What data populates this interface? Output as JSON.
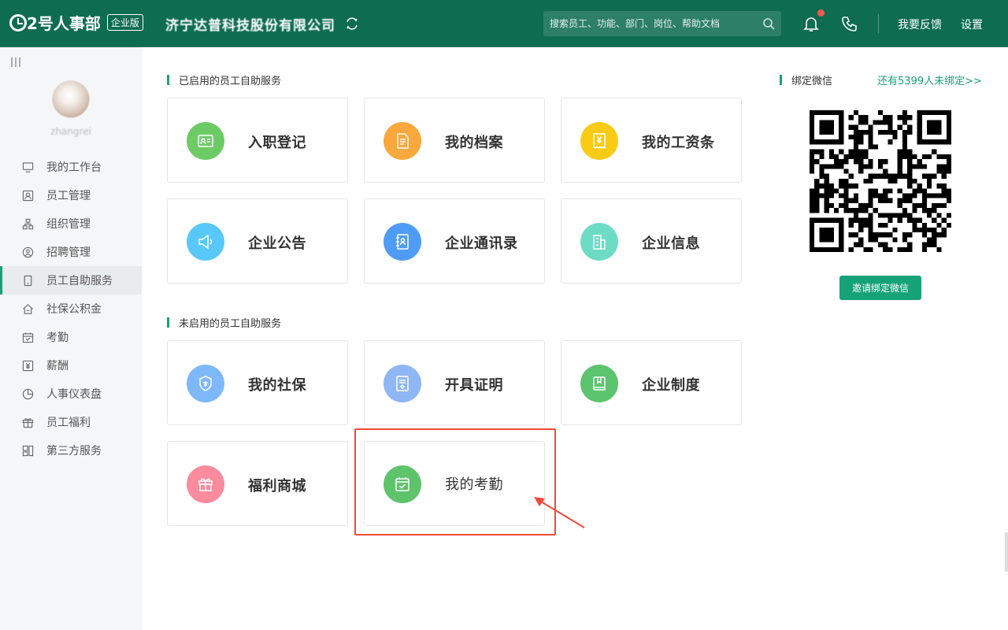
{
  "topbar": {
    "logo_text": "2号人事部",
    "edition": "企业版",
    "company": "济宁达普科技股份有限公司",
    "search_placeholder": "搜索员工、功能、部门、岗位、帮助文档",
    "feedback": "我要反馈",
    "settings": "设置"
  },
  "sidebar": {
    "username": "zhangrei",
    "items": [
      {
        "label": "我的工作台",
        "icon": "monitor-icon"
      },
      {
        "label": "员工管理",
        "icon": "id-card-icon"
      },
      {
        "label": "组织管理",
        "icon": "org-chart-icon"
      },
      {
        "label": "招聘管理",
        "icon": "recruit-icon"
      },
      {
        "label": "员工自助服务",
        "icon": "mobile-icon",
        "active": true
      },
      {
        "label": "社保公积金",
        "icon": "house-icon"
      },
      {
        "label": "考勤",
        "icon": "calendar-icon"
      },
      {
        "label": "薪酬",
        "icon": "yen-icon"
      },
      {
        "label": "人事仪表盘",
        "icon": "pie-icon"
      },
      {
        "label": "员工福利",
        "icon": "gift-icon"
      },
      {
        "label": "第三方服务",
        "icon": "apps-icon"
      }
    ]
  },
  "main": {
    "enabled_title": "已启用的员工自助服务",
    "disabled_title": "未启用的员工自助服务",
    "enabled": [
      {
        "label": "入职登记",
        "color": "#6dcb66",
        "icon": "id-card-icon"
      },
      {
        "label": "我的档案",
        "color": "#f8a83c",
        "icon": "document-icon"
      },
      {
        "label": "我的工资条",
        "color": "#f9cb14",
        "icon": "payslip-icon"
      },
      {
        "label": "企业公告",
        "color": "#58c8fa",
        "icon": "megaphone-icon"
      },
      {
        "label": "企业通讯录",
        "color": "#4f9cf6",
        "icon": "contacts-book-icon"
      },
      {
        "label": "企业信息",
        "color": "#6ddcc5",
        "icon": "building-icon"
      }
    ],
    "disabled": [
      {
        "label": "我的社保",
        "color": "#7fb7fb",
        "icon": "shield-icon"
      },
      {
        "label": "开具证明",
        "color": "#8fb6f5",
        "icon": "certificate-icon"
      },
      {
        "label": "企业制度",
        "color": "#5dc46e",
        "icon": "rules-book-icon"
      },
      {
        "label": "福利商城",
        "color": "#fb8b9d",
        "icon": "gift-icon"
      },
      {
        "label": "我的考勤",
        "color": "#5fc36b",
        "icon": "calendar-check-icon"
      }
    ]
  },
  "wechat": {
    "title": "绑定微信",
    "unbound": "还有5399人未绑定>>",
    "invite_button": "邀请绑定微信"
  }
}
